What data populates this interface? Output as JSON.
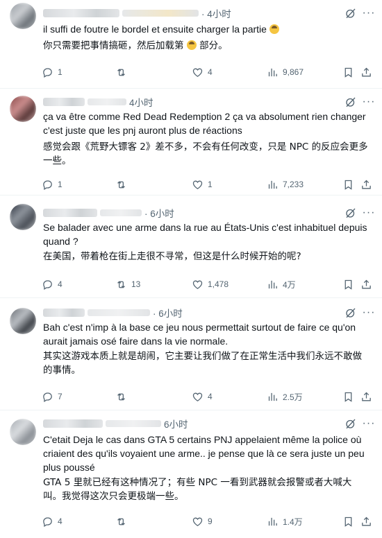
{
  "tweets": [
    {
      "time": "· 4小时",
      "text": "il suffi de foutre le bordel et ensuite charger la partie",
      "translation": "你只需要把事情搞砸，然后加载第",
      "translation_tail": "部分。",
      "replies": "1",
      "reposts": "",
      "likes": "4",
      "views": "9,867"
    },
    {
      "time": "4小时",
      "text": "ça va être comme Red Dead Redemption 2 ça va absolument rien changer c'est juste que les pnj auront plus de réactions",
      "translation": "感觉会跟《荒野大镖客 2》差不多，不会有任何改变，只是 NPC 的反应会更多一些。",
      "replies": "1",
      "reposts": "",
      "likes": "1",
      "views": "7,233"
    },
    {
      "time": "· 6小时",
      "text": "Se balader avec une arme dans la rue au États-Unis c'est inhabituel depuis quand ?",
      "translation": "在美国，带着枪在街上走很不寻常，但这是什么时候开始的呢?",
      "replies": "4",
      "reposts": "13",
      "likes": "1,478",
      "views": "4万"
    },
    {
      "time": "· 6小时",
      "text": "Bah c'est n'imp à la base ce jeu nous permettait surtout de faire ce qu'on aurait jamais osé faire dans la vie normale.",
      "translation": "其实这游戏本质上就是胡闹，它主要让我们做了在正常生活中我们永远不敢做的事情。",
      "replies": "7",
      "reposts": "",
      "likes": "4",
      "views": "2.5万"
    },
    {
      "time": "6小时",
      "text": "C'etait Deja le cas dans GTA 5 certains PNJ appelaient même la police où criaient des qu'ils voyaient une arme.. je pense que là ce sera juste un peu plus poussé",
      "translation": "GTA 5 里就已经有这种情况了；有些 NPC 一看到武器就会报警或者大喊大叫。我觉得这次只会更极端一些。",
      "replies": "4",
      "reposts": "",
      "likes": "9",
      "views": "1.4万"
    }
  ],
  "colors": {
    "muted": "#536471",
    "text": "#0f1419",
    "divider": "#eff3f4"
  },
  "icons": [
    "grok-icon",
    "more-icon",
    "reply-icon",
    "repost-icon",
    "like-icon",
    "views-icon",
    "bookmark-icon",
    "share-icon"
  ]
}
